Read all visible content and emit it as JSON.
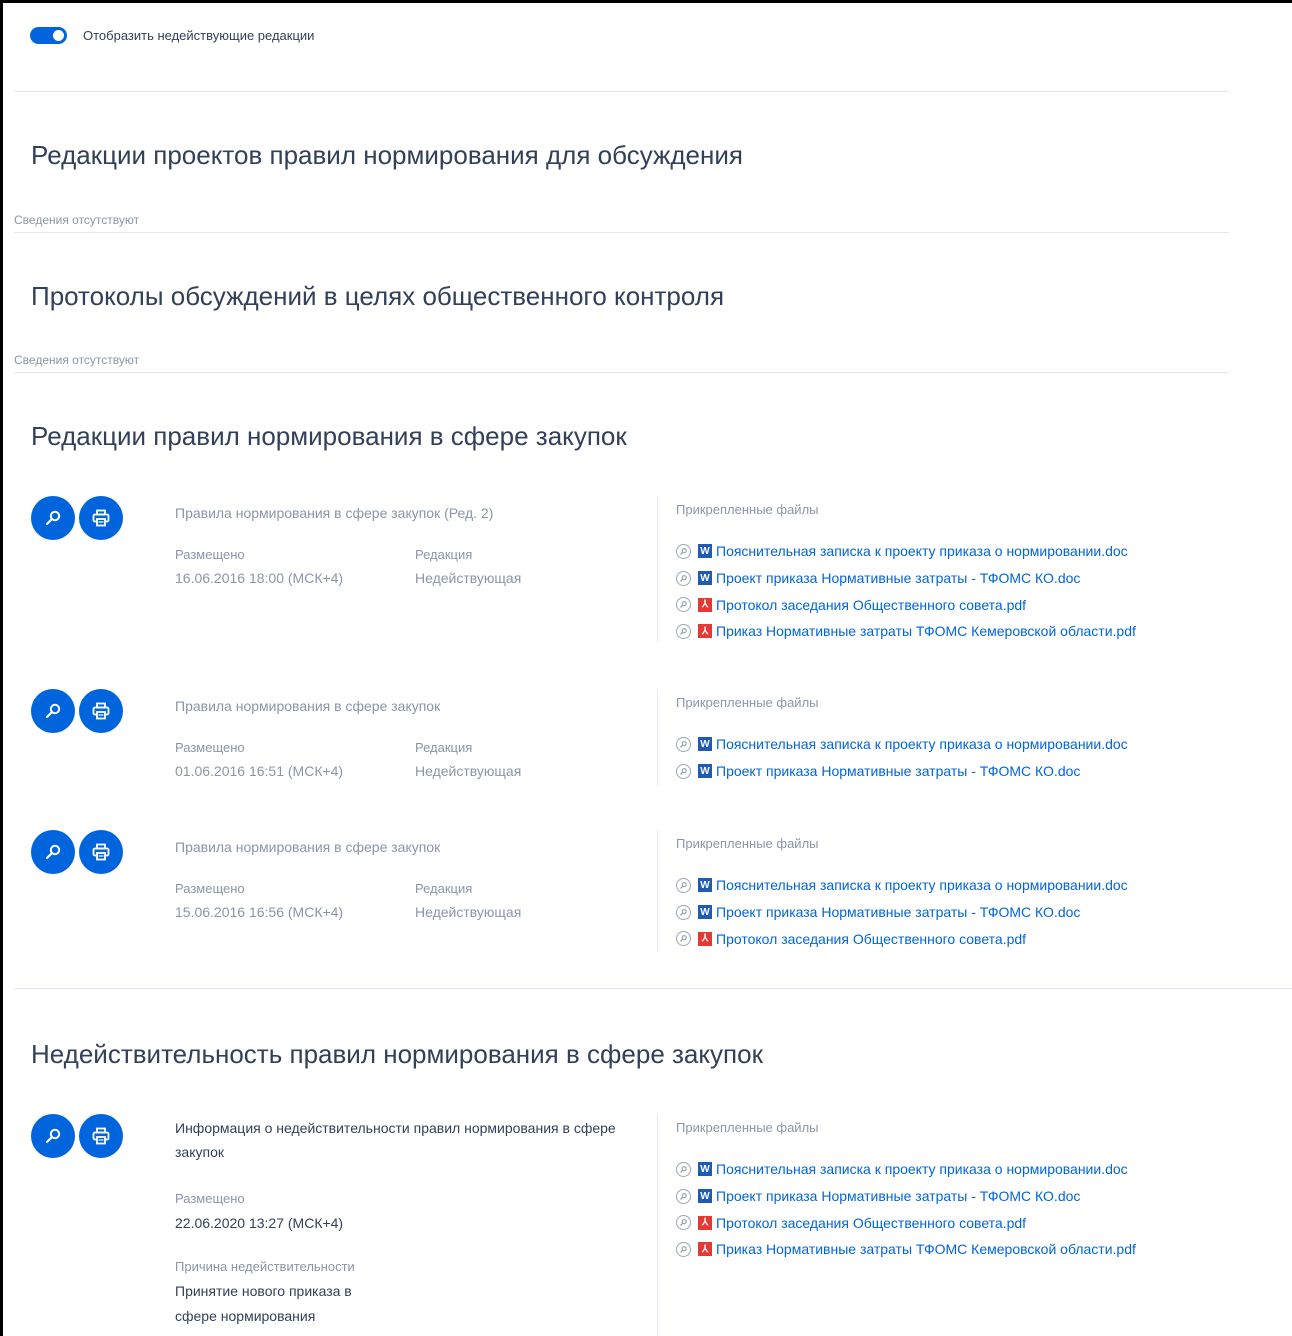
{
  "toggle": {
    "label": "Отобразить недействующие редакции",
    "on": true
  },
  "sections": {
    "drafts": {
      "title": "Редакции проектов правил нормирования для обсуждения",
      "empty": "Сведения отсутствуют"
    },
    "protocols": {
      "title": "Протоколы обсуждений в целях общественного контроля",
      "empty": "Сведения отсутствуют"
    },
    "editions": {
      "title": "Редакции правил нормирования в сфере закупок",
      "records": [
        {
          "title": "Правила нормирования в сфере закупок (Ред. 2)",
          "posted_label": "Размещено",
          "posted_value": "16.06.2016 18:00 (МСК+4)",
          "edition_label": "Редакция",
          "edition_value": "Недействующая",
          "files_label": "Прикрепленные файлы",
          "files": [
            {
              "type": "word",
              "name": "Пояснительная записка к проекту приказа о нормировании.doc"
            },
            {
              "type": "word",
              "name": "Проект приказа Нормативные затраты - ТФОМС КО.doc"
            },
            {
              "type": "pdf",
              "name": "Протокол заседания Общественного совета.pdf"
            },
            {
              "type": "pdf",
              "name": "Приказ Нормативные затраты ТФОМС Кемеровской области.pdf"
            }
          ]
        },
        {
          "title": "Правила нормирования в сфере закупок",
          "posted_label": "Размещено",
          "posted_value": "01.06.2016 16:51 (МСК+4)",
          "edition_label": "Редакция",
          "edition_value": "Недействующая",
          "files_label": "Прикрепленные файлы",
          "files": [
            {
              "type": "word",
              "name": "Пояснительная записка к проекту приказа о нормировании.doc"
            },
            {
              "type": "word",
              "name": "Проект приказа Нормативные затраты - ТФОМС КО.doc"
            }
          ]
        },
        {
          "title": "Правила нормирования в сфере закупок",
          "posted_label": "Размещено",
          "posted_value": "15.06.2016 16:56 (МСК+4)",
          "edition_label": "Редакция",
          "edition_value": "Недействующая",
          "files_label": "Прикрепленные файлы",
          "files": [
            {
              "type": "word",
              "name": "Пояснительная записка к проекту приказа о нормировании.doc"
            },
            {
              "type": "word",
              "name": "Проект приказа Нормативные затраты - ТФОМС КО.doc"
            },
            {
              "type": "pdf",
              "name": "Протокол заседания Общественного совета.pdf"
            }
          ]
        }
      ]
    },
    "invalidity": {
      "title": "Недействительность правил нормирования в сфере закупок",
      "record": {
        "title": "Информация о недействительности правил нормирования в сфере закупок",
        "posted_label": "Размещено",
        "posted_value": "22.06.2020 13:27 (МСК+4)",
        "reason_label": "Причина недействительности",
        "reason_line1": "Принятие нового приказа в",
        "reason_line2": "сфере нормирования",
        "files_label": "Прикрепленные файлы",
        "files": [
          {
            "type": "word",
            "name": "Пояснительная записка к проекту приказа о нормировании.doc"
          },
          {
            "type": "word",
            "name": "Проект приказа Нормативные затраты - ТФОМС КО.doc"
          },
          {
            "type": "pdf",
            "name": "Протокол заседания Общественного совета.pdf"
          },
          {
            "type": "pdf",
            "name": "Приказ Нормативные затраты ТФОМС Кемеровской области.pdf"
          }
        ]
      }
    }
  },
  "colors": {
    "accent": "#0065dd",
    "text": "#334059",
    "muted": "#8a96a8",
    "divider": "#e4e7f2",
    "word": "#1f5bb5",
    "pdf": "#e53935"
  },
  "icons": {
    "view": "search-key-icon",
    "print": "printer-icon",
    "signature": "signature-check-icon",
    "word": "word-file-icon",
    "pdf": "pdf-file-icon"
  }
}
